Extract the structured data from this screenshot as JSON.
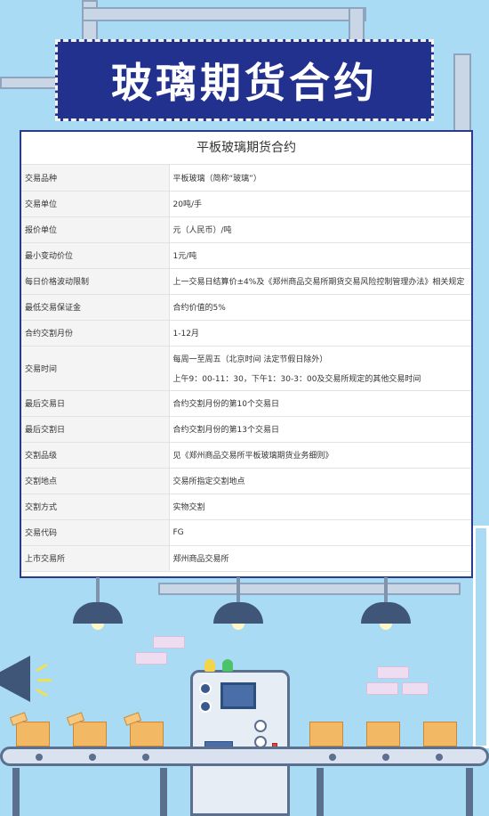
{
  "banner": {
    "title": "玻璃期货合约"
  },
  "contract": {
    "title": "平板玻璃期货合约",
    "rows": [
      {
        "key": "交易品种",
        "value": "平板玻璃（简称“玻璃”）"
      },
      {
        "key": "交易单位",
        "value": "20吨/手"
      },
      {
        "key": "报价单位",
        "value": "元（人民币）/吨"
      },
      {
        "key": "最小变动价位",
        "value": "1元/吨"
      },
      {
        "key": "每日价格波动限制",
        "value": "上一交易日结算价±4%及《郑州商品交易所期货交易风险控制管理办法》相关规定"
      },
      {
        "key": "最低交易保证金",
        "value": "合约价值的5%"
      },
      {
        "key": "合约交割月份",
        "value": "1-12月"
      },
      {
        "key": "交易时间",
        "value": "每周一至周五（北京时间 法定节假日除外）",
        "value2": "上午9：00-11：30，下午1：30-3：00及交易所规定的其他交易时间"
      },
      {
        "key": "最后交易日",
        "value": "合约交割月份的第10个交易日"
      },
      {
        "key": "最后交割日",
        "value": "合约交割月份的第13个交易日"
      },
      {
        "key": "交割品级",
        "value": "见《郑州商品交易所平板玻璃期货业务细则》"
      },
      {
        "key": "交割地点",
        "value": "交易所指定交割地点"
      },
      {
        "key": "交割方式",
        "value": "实物交割"
      },
      {
        "key": "交易代码",
        "value": "FG"
      },
      {
        "key": "上市交易所",
        "value": "郑州商品交易所"
      }
    ]
  }
}
